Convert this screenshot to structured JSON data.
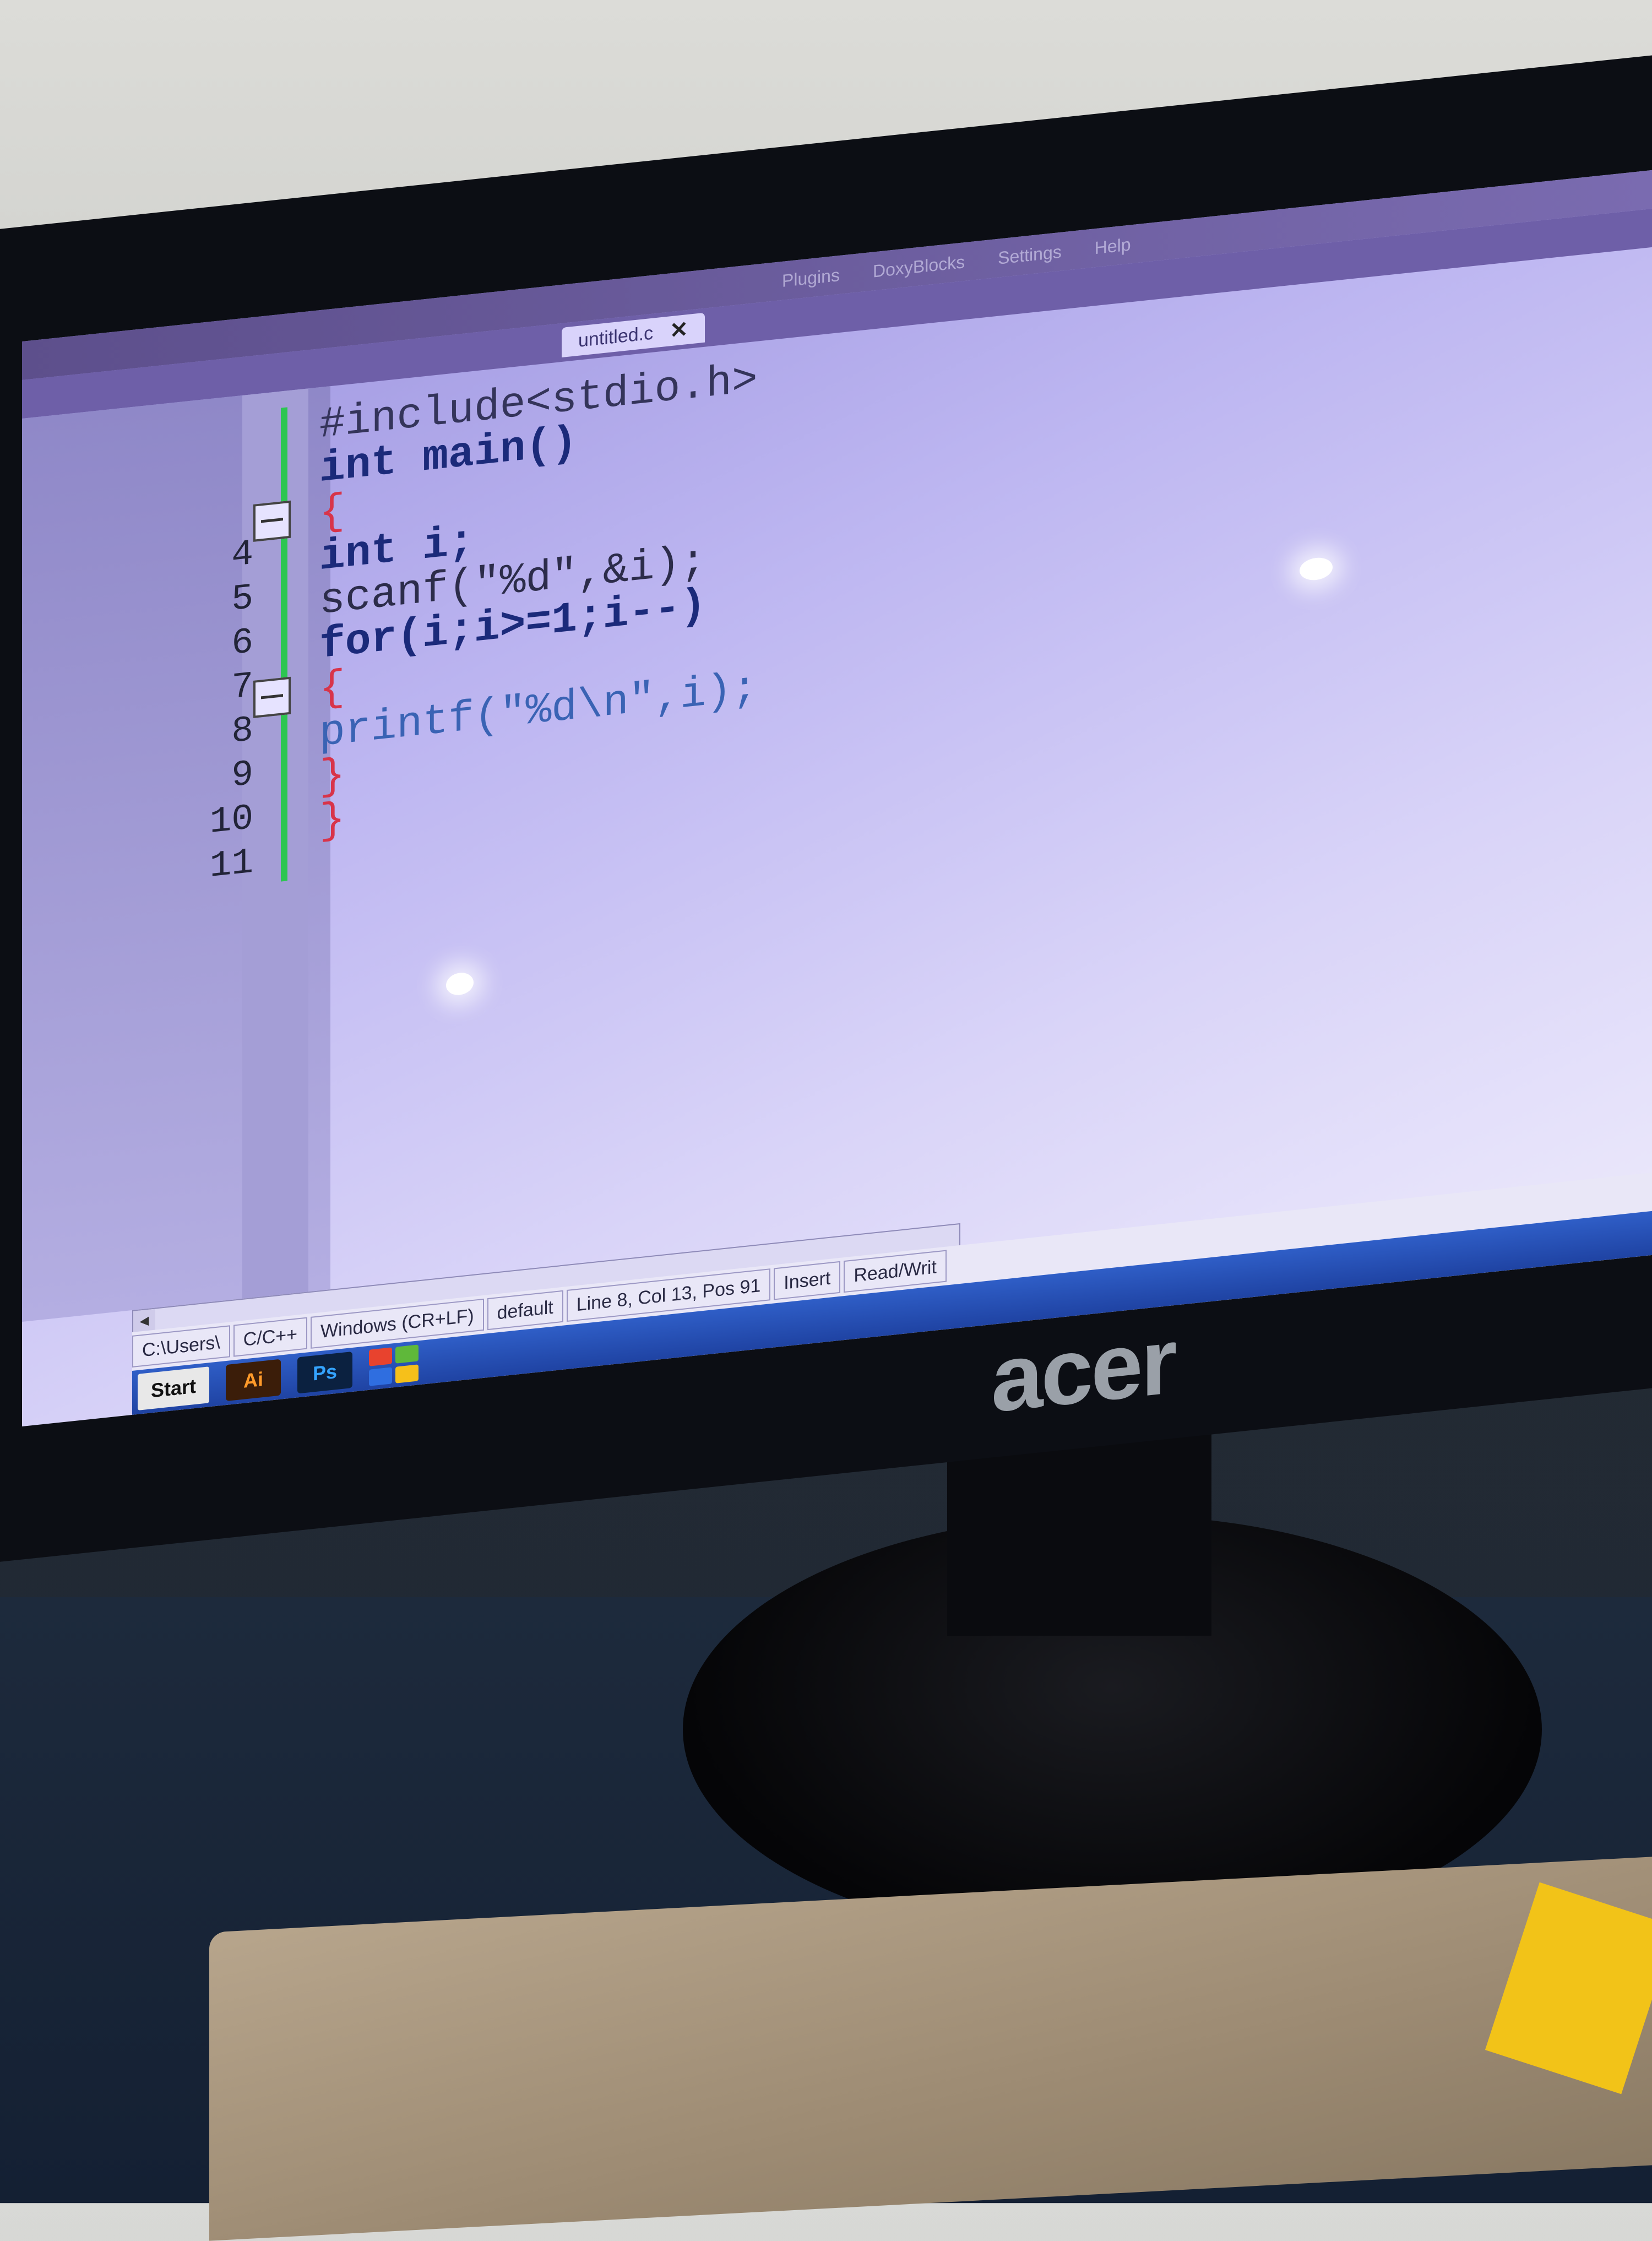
{
  "editor": {
    "tab_title": "untitled.c",
    "tab_close": "✕",
    "menu": [
      "Plugins",
      "DoxyBlocks",
      "Settings",
      "Help"
    ],
    "line_numbers": [
      "4",
      "5",
      "6",
      "7",
      "8",
      "9",
      "10",
      "11"
    ],
    "code_lines": [
      "#include<stdio.h>",
      "int main()",
      "{",
      "int i;",
      "scanf(\"%d\",&i);",
      "for(i;i>=1;i--)",
      "{",
      "printf(\"%d\\n\",i);",
      "}",
      "}"
    ]
  },
  "statusbar": {
    "path": "C:\\Users\\",
    "language": "C/C++",
    "eol": "Windows (CR+LF)",
    "encoding": "default",
    "position": "Line 8, Col 13, Pos 91",
    "mode": "Insert",
    "access": "Read/Writ"
  },
  "taskbar": {
    "start_label": "Start",
    "apps": [
      "Ai",
      "Ps"
    ]
  },
  "monitor": {
    "brand": "acer"
  }
}
